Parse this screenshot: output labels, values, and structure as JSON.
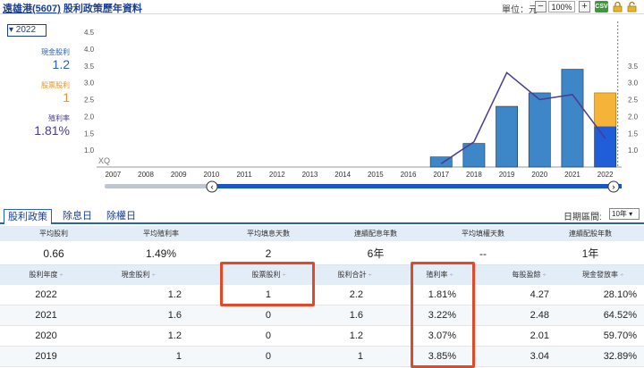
{
  "header": {
    "stock_name": "遠雄港(5607)",
    "title": "股利政策歷年資料",
    "unit_label": "單位：元",
    "zoom": "100%",
    "minus": "−",
    "plus": "+",
    "csv": "CSV"
  },
  "left_panel": {
    "year_selected": "▾ 2022",
    "cash_dividend_label": "現金股利",
    "cash_dividend_value": "1.2",
    "stock_dividend_label": "股票股利",
    "stock_dividend_value": "1",
    "yield_label": "殖利率",
    "yield_value": "1.81%"
  },
  "colors": {
    "cash_bar": "#3d86c8",
    "cash_bar_selected": "#1f5ed8",
    "stock_bar": "#f5b337",
    "yield_line": "#4b3a8f",
    "highlight": "#e04a2a",
    "scrollbar": "#1a56c4"
  },
  "chart_data": {
    "type": "bar",
    "categories": [
      "2007",
      "2008",
      "2009",
      "2010",
      "2011",
      "2012",
      "2013",
      "2014",
      "2015",
      "2016",
      "2017",
      "2018",
      "2019",
      "2020",
      "2021",
      "2022"
    ],
    "series": [
      {
        "name": "現金股利",
        "values": [
          0,
          0,
          0,
          0,
          0,
          0,
          0,
          0,
          0,
          0,
          0.3,
          0.7,
          1.8,
          2.2,
          2.9,
          1.2
        ]
      },
      {
        "name": "股票股利",
        "values": [
          0,
          0,
          0,
          0,
          0,
          0,
          0,
          0,
          0,
          0,
          0,
          0,
          0,
          0,
          0,
          1
        ]
      },
      {
        "name": "殖利率",
        "values": [
          null,
          null,
          null,
          null,
          null,
          null,
          null,
          null,
          null,
          null,
          0.1,
          0.75,
          2.8,
          2.0,
          2.15,
          0.85
        ]
      }
    ],
    "left_axis_ticks": [
      "4.5",
      "4.0",
      "3.5",
      "3.0",
      "2.5",
      "2.0",
      "1.5",
      "1.0"
    ],
    "right_axis_ticks": [
      "3.5",
      "3.0",
      "2.5",
      "2.0",
      "1.5",
      "1.0"
    ],
    "ylim": [
      0.5,
      4.5
    ],
    "watermark": "XQ"
  },
  "tabs": [
    "股利政策",
    "除息日",
    "除權日"
  ],
  "date_range": {
    "label": "日期區間:",
    "value": "10年 ▾"
  },
  "summary": {
    "headers": [
      "平均股利",
      "平均殖利率",
      "平均填息天數",
      "連續配息年數",
      "平均填權天數",
      "連續配股年數"
    ],
    "values": [
      "0.66",
      "1.49%",
      "2",
      "6年",
      "--",
      "1年"
    ]
  },
  "detail": {
    "headers": [
      "股利年度",
      "現金股利",
      "股票股利",
      "股利合計",
      "殖利率",
      "每股盈餘",
      "現金發放率"
    ],
    "sort_glyph": "÷",
    "rows": [
      [
        "2022",
        "1.2",
        "1",
        "2.2",
        "1.81%",
        "4.27",
        "28.10%"
      ],
      [
        "2021",
        "1.6",
        "0",
        "1.6",
        "3.22%",
        "2.48",
        "64.52%"
      ],
      [
        "2020",
        "1.2",
        "0",
        "1.2",
        "3.07%",
        "2.01",
        "59.70%"
      ],
      [
        "2019",
        "1",
        "0",
        "1",
        "3.85%",
        "3.04",
        "32.89%"
      ]
    ]
  }
}
